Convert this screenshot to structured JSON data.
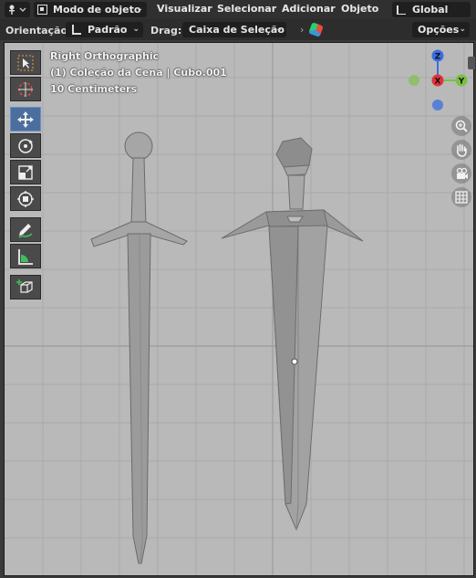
{
  "header": {
    "mode_label": "Modo de objeto",
    "menus": [
      "Visualizar",
      "Selecionar",
      "Adicionar",
      "Objeto"
    ],
    "transform_orientation": "Global"
  },
  "tool_settings": {
    "orientation_label": "Orientação:",
    "orientation_value": "Padrão",
    "drag_label": "Drag:",
    "drag_value": "Caixa de Seleção",
    "options_label": "Opções"
  },
  "viewport": {
    "view_name": "Right Orthographic",
    "collection_info": "(1) Coleção da Cena | Cubo.001",
    "grid_scale": "10 Centimeters",
    "gizmo": {
      "z_label": "Z",
      "y_label": "Y",
      "x_label": "X",
      "colors": {
        "z": "#3b6ee0",
        "y": "#7ac143",
        "x": "#e0323c"
      }
    }
  },
  "tools": [
    {
      "name": "select-box",
      "icon": "cursor-select-icon",
      "active": false
    },
    {
      "name": "cursor",
      "icon": "3d-cursor-icon",
      "active": false
    },
    {
      "name": "move",
      "icon": "move-arrows-icon",
      "active": true
    },
    {
      "name": "rotate",
      "icon": "rotate-icon",
      "active": false
    },
    {
      "name": "scale",
      "icon": "scale-icon",
      "active": false
    },
    {
      "name": "transform",
      "icon": "transform-icon",
      "active": false
    },
    {
      "name": "annotate",
      "icon": "annotate-pencil-icon",
      "active": false
    },
    {
      "name": "measure",
      "icon": "measure-ruler-icon",
      "active": false
    },
    {
      "name": "add-cube",
      "icon": "add-cube-icon",
      "active": false
    }
  ],
  "nav_buttons": [
    "zoom-icon",
    "hand-pan-icon",
    "camera-view-icon",
    "ortho-grid-icon"
  ]
}
